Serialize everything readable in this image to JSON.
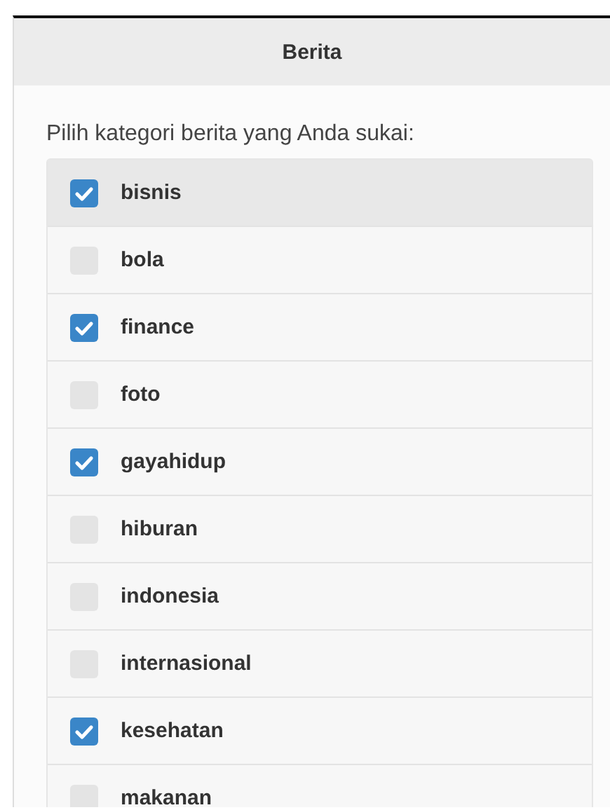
{
  "header": {
    "title": "Berita"
  },
  "prompt": "Pilih kategori berita yang Anda sukai:",
  "categories": [
    {
      "label": "bisnis",
      "checked": true,
      "selected": true
    },
    {
      "label": "bola",
      "checked": false,
      "selected": false
    },
    {
      "label": "finance",
      "checked": true,
      "selected": false
    },
    {
      "label": "foto",
      "checked": false,
      "selected": false
    },
    {
      "label": "gayahidup",
      "checked": true,
      "selected": false
    },
    {
      "label": "hiburan",
      "checked": false,
      "selected": false
    },
    {
      "label": "indonesia",
      "checked": false,
      "selected": false
    },
    {
      "label": "internasional",
      "checked": false,
      "selected": false
    },
    {
      "label": "kesehatan",
      "checked": true,
      "selected": false
    },
    {
      "label": "makanan",
      "checked": false,
      "selected": false
    }
  ]
}
